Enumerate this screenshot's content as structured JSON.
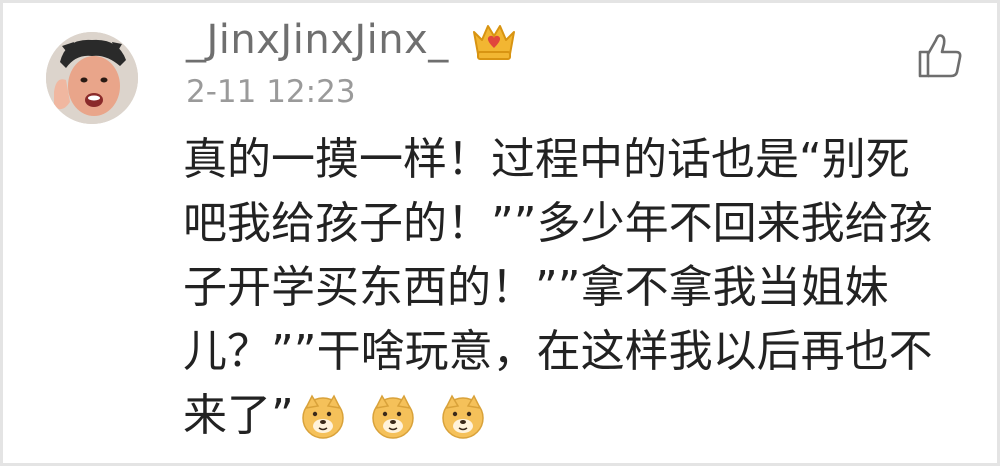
{
  "comment": {
    "username": "_JinxJinxJinx_",
    "timestamp": "2-11 12:23",
    "body_lines": [
      "真的一摸一样！过程中的话也是“别死",
      "吧我给孩子的！””多少年不回来我给孩",
      "子开学买东西的！””拿不拿我当姐妹",
      "儿？””干啥玩意，在这样我以后再也不",
      "来了”"
    ],
    "emojis": [
      "doge-emoji",
      "doge-emoji",
      "doge-emoji"
    ]
  },
  "icons": {
    "avatar": "user-avatar",
    "badge": "vip-crown-icon",
    "like": "thumbs-up-icon"
  },
  "colors": {
    "username": "#6f6f6f",
    "timestamp": "#9a9a9a",
    "body_text": "#222222",
    "badge_gold": "#f2b632",
    "badge_red": "#e0463c"
  }
}
